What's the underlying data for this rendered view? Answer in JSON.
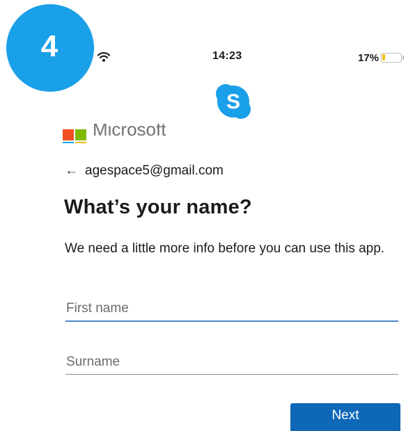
{
  "step_badge": {
    "number": "4",
    "color": "#1aa0e8"
  },
  "status_bar": {
    "wifi_icon": "wifi-icon",
    "time": "14:23",
    "battery_percent": "17%",
    "battery_level": 0.17,
    "battery_fill_color": "#f2c417"
  },
  "app_logo": {
    "icon": "skype-logo-icon",
    "letter": "S",
    "color": "#1aa0e8"
  },
  "microsoft": {
    "wordmark": "Microsoft",
    "logo_colors": [
      "#f25022",
      "#7fba00",
      "#00a4ef",
      "#ffb900"
    ]
  },
  "back_row": {
    "arrow": "←",
    "email": "agespace5@gmail.com"
  },
  "title": "What’s your name?",
  "description": "We need a little more info before you can use this app.",
  "form": {
    "first_name": {
      "placeholder": "First name",
      "value": ""
    },
    "surname": {
      "placeholder": "Surname",
      "value": ""
    }
  },
  "next_button": {
    "label": "Next",
    "color": "#0f67b8"
  }
}
